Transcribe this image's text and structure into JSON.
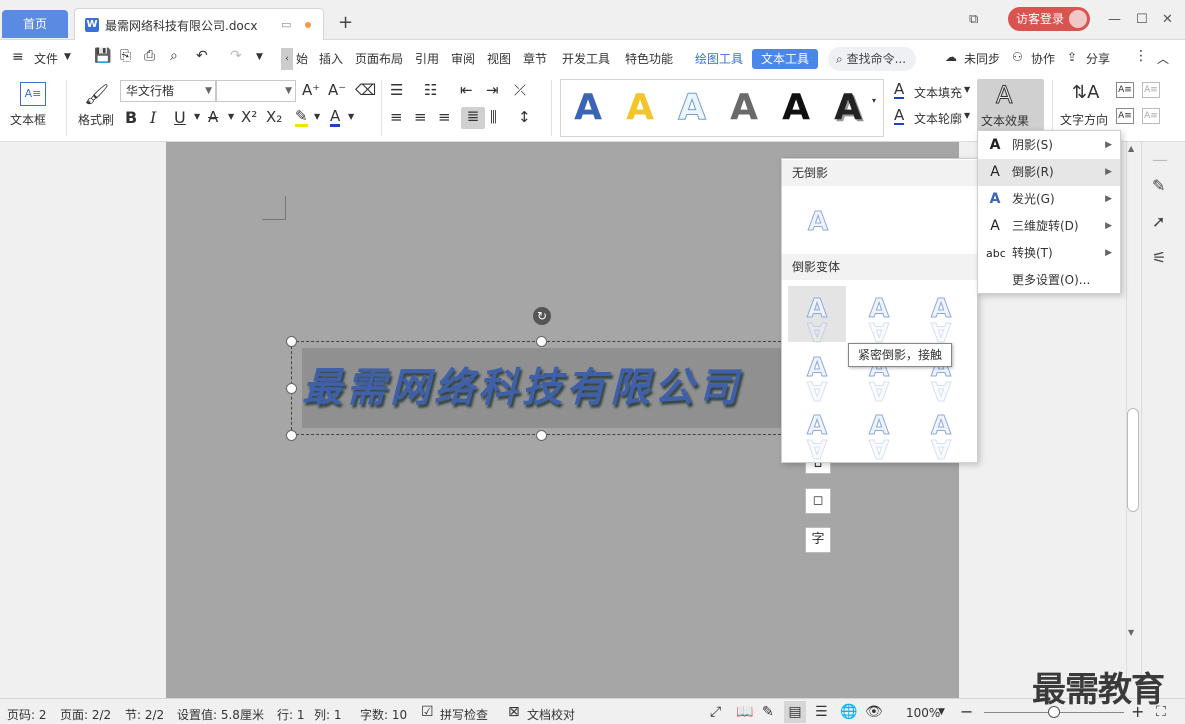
{
  "titlebar": {
    "home_tab": "首页",
    "doc_tab": "最需网络科技有限公司.docx",
    "login": "访客登录"
  },
  "menu": {
    "file": "文件",
    "items": [
      "开始",
      "插入",
      "页面布局",
      "引用",
      "审阅",
      "视图",
      "章节",
      "开发工具",
      "特色功能"
    ],
    "drawing_tools": "绘图工具",
    "text_tools": "文本工具",
    "search": "查找命令...",
    "unsynced": "未同步",
    "collab": "协作",
    "share": "分享"
  },
  "toolbar": {
    "textbox_label": "文本框",
    "format_painter": "格式刷",
    "font_name": "华文行楷",
    "font_size": "",
    "text_fill": "文本填充",
    "text_outline": "文本轮廓",
    "text_effects": "文本效果",
    "text_direction": "文字方向"
  },
  "document": {
    "art_text": "最需网络科技有限公司"
  },
  "reflection_panel": {
    "no_reflection": "无倒影",
    "variants": "倒影变体",
    "tooltip": "紧密倒影，接触"
  },
  "effects_menu": {
    "items": [
      {
        "label": "阴影(S)",
        "icon": "A"
      },
      {
        "label": "倒影(R)",
        "icon": "A"
      },
      {
        "label": "发光(G)",
        "icon": "A"
      },
      {
        "label": "三维旋转(D)",
        "icon": "A"
      },
      {
        "label": "转换(T)",
        "icon": "abc"
      },
      {
        "label": "更多设置(O)..."
      }
    ]
  },
  "statusbar": {
    "page_code": "页码: 2",
    "page": "页面: 2/2",
    "section": "节: 2/2",
    "setting": "设置值: 5.8厘米",
    "row": "行: 1",
    "col": "列: 1",
    "words": "字数: 10",
    "spell": "拼写检查",
    "doc_check": "文档校对",
    "zoom": "100%",
    "zoom_fraction": 0.5
  },
  "watermark": "最需教育",
  "colors": {
    "accent": "#4a87e8",
    "login": "#d9534f",
    "page_bg": "#a6a6a6",
    "art_text": "#3f5fa8"
  }
}
